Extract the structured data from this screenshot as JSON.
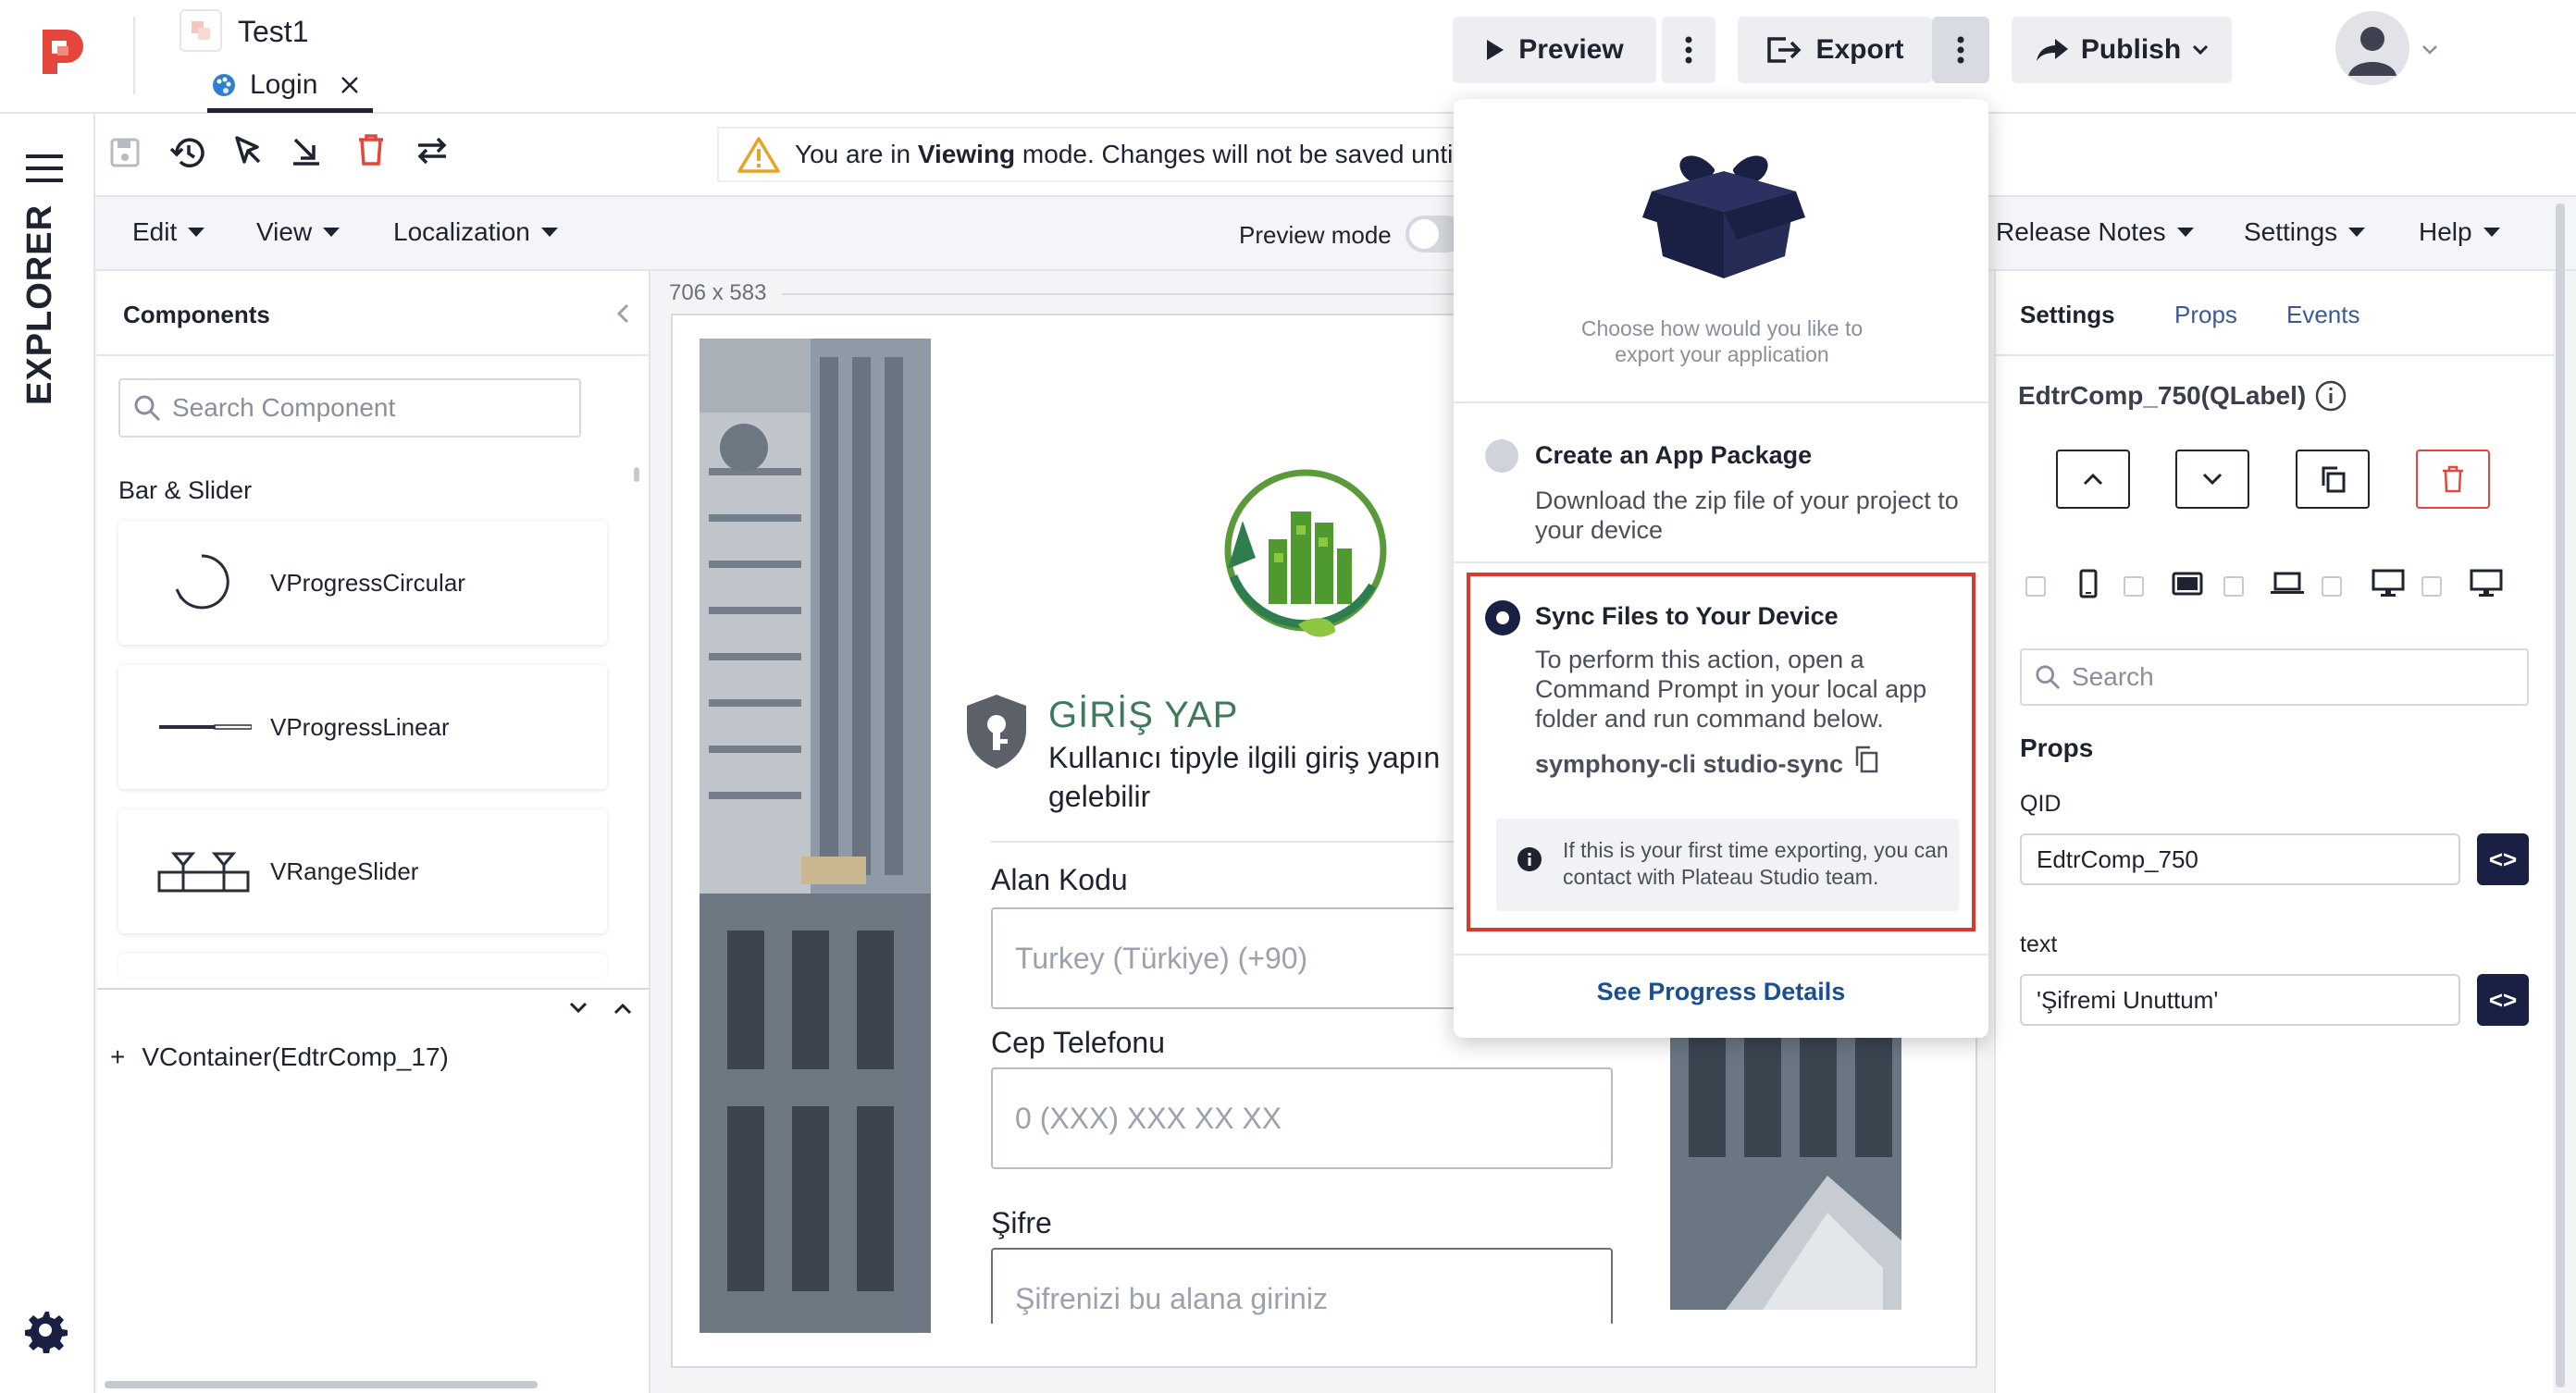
{
  "app": {
    "project_name": "Test1",
    "page_tab": "Login"
  },
  "topbar": {
    "preview_label": "Preview",
    "export_label": "Export",
    "publish_label": "Publish"
  },
  "rail": {
    "explorer_label": "EXPLORER"
  },
  "toolbar": {
    "notice_prefix": "You are in ",
    "notice_bold": "Viewing",
    "notice_suffix": " mode. Changes will not be saved until"
  },
  "menubar": {
    "edit": "Edit",
    "view": "View",
    "localization": "Localization",
    "preview_mode": "Preview mode",
    "release_notes": "Release Notes",
    "settings": "Settings",
    "help": "Help"
  },
  "components_panel": {
    "title": "Components",
    "search_placeholder": "Search Component",
    "section": "Bar & Slider",
    "items": [
      {
        "label": "VProgressCircular"
      },
      {
        "label": "VProgressLinear"
      },
      {
        "label": "VRangeSlider"
      }
    ],
    "tree_item": "VContainer(EdtrComp_17)"
  },
  "canvas": {
    "size_label": "706 x 583",
    "login": {
      "title": "GİRİŞ YAP",
      "subtitle_line1": "Kullanıcı tipyle ilgili giriş yapın",
      "subtitle_line2": "gelebilir",
      "area_code_label": "Alan Kodu",
      "area_code_placeholder": "Turkey (Türkiye) (+90)",
      "phone_label": "Cep Telefonu",
      "phone_placeholder": "0 (XXX) XXX XX XX",
      "password_label": "Şifre",
      "password_placeholder": "Şifrenizi bu alana giriniz"
    }
  },
  "right_panel": {
    "tabs": [
      "Settings",
      "Props",
      "Events"
    ],
    "component_title": "EdtrComp_750(QLabel)",
    "search_placeholder": "Search",
    "props_heading": "Props",
    "qid_label": "QID",
    "qid_value": "EdtrComp_750",
    "text_label": "text",
    "text_value": "'Şifremi Unuttum'"
  },
  "export_popup": {
    "intro": "Choose how would you like to export your application",
    "option1_title": "Create an App Package",
    "option1_desc": "Download the zip file of your project to your device",
    "option2_title": "Sync Files to Your Device",
    "option2_desc": "To perform this action, open a Command Prompt in your local app folder and run command below.",
    "command": "symphony-cli studio-sync",
    "info": "If this is your first time exporting, you can contact with Plateau Studio team.",
    "progress_link": "See Progress Details",
    "selected_option": 2
  },
  "colors": {
    "brand_red": "#e4463c",
    "navy": "#1a2044",
    "highlight_border": "#d93a2b",
    "link_blue": "#1b4f8f",
    "login_green": "#3d7a5a"
  }
}
